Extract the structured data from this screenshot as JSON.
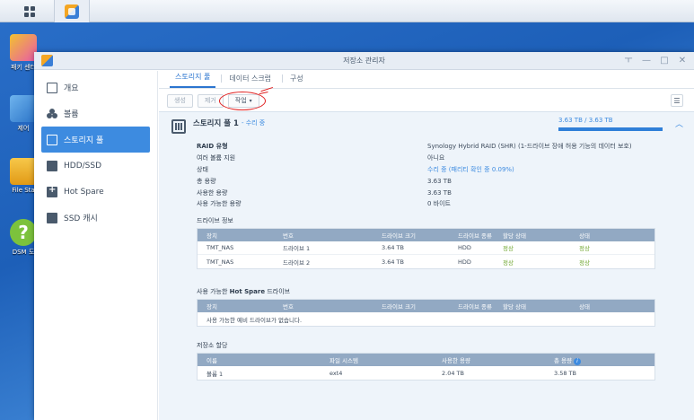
{
  "window": {
    "title": "저장소 관리자"
  },
  "desktop_icons": [
    {
      "label": "패키 센터"
    },
    {
      "label": "제어"
    },
    {
      "label": "File Sta"
    },
    {
      "label": "DSM 도"
    }
  ],
  "window_controls": {
    "pin": "ㅜ",
    "minimize": "—",
    "maximize": "□",
    "close": "✕"
  },
  "sidebar": {
    "items": [
      {
        "label": "개요",
        "icon": "overview-icon"
      },
      {
        "label": "볼륨",
        "icon": "volume-icon"
      },
      {
        "label": "스토리지 풀",
        "icon": "storage-pool-icon"
      },
      {
        "label": "HDD/SSD",
        "icon": "hdd-icon"
      },
      {
        "label": "Hot Spare",
        "icon": "hot-spare-icon"
      },
      {
        "label": "SSD 캐시",
        "icon": "ssd-cache-icon"
      }
    ]
  },
  "tabs": [
    "스토리지 풀",
    "데이터 스크럽",
    "구성"
  ],
  "toolbar": {
    "create": "생성",
    "remove": "제거",
    "action": "작업",
    "action_caret": "▾",
    "list_toggle": "☰"
  },
  "pool": {
    "name": "스토리지 풀 1",
    "status": "- 수리 중",
    "capacity_text": "3.63 TB / 3.63 TB",
    "capacity_used_fraction": 1.0,
    "collapse": "︿",
    "properties": [
      {
        "key": "RAID 유형",
        "value": "Synology Hybrid RAID (SHR) (1-드라이브 장애 허용 기능의 데이터 보호)",
        "bold": true
      },
      {
        "key": "여러 볼륨 지원",
        "value": "아니요"
      },
      {
        "key": "상태",
        "value": "수리 중 (패리티 확인 중 0.09%)",
        "link": true
      },
      {
        "key": "총 용량",
        "value": "3.63 TB"
      },
      {
        "key": "사용한 용량",
        "value": "3.63 TB"
      },
      {
        "key": "사용 가능한 용량",
        "value": "0 바이트"
      }
    ]
  },
  "drive_info": {
    "title": "드라이브 정보",
    "headers": [
      "장치",
      "번호",
      "드라이브 크기",
      "드라이브 종류",
      "할당 상태",
      "상태"
    ],
    "rows": [
      [
        "TMT_NAS",
        "드라이브 1",
        "3.64 TB",
        "HDD",
        "정상",
        "정상"
      ],
      [
        "TMT_NAS",
        "드라이브 2",
        "3.64 TB",
        "HDD",
        "정상",
        "정상"
      ]
    ]
  },
  "hot_spare": {
    "title_prefix": "사용 가능한 ",
    "title_bold": "Hot Spare",
    "title_suffix": " 드라이브",
    "headers": [
      "장치",
      "번호",
      "드라이브 크기",
      "드라이브 종류",
      "할당 상태",
      "상태"
    ],
    "empty_message": "사용 가능한 예비 드라이브가 없습니다."
  },
  "storage_alloc": {
    "title": "저장소 할당",
    "headers": [
      "이름",
      "파일 시스템",
      "사용한 용량",
      "총 용량"
    ],
    "info_icon": "i",
    "rows": [
      [
        "볼륨 1",
        "ext4",
        "2.04 TB",
        "3.58 TB"
      ]
    ]
  },
  "colors": {
    "accent": "#3d8be0",
    "ok": "#6aa328",
    "annotation": "#e02020",
    "table_header": "#92a9c3"
  }
}
